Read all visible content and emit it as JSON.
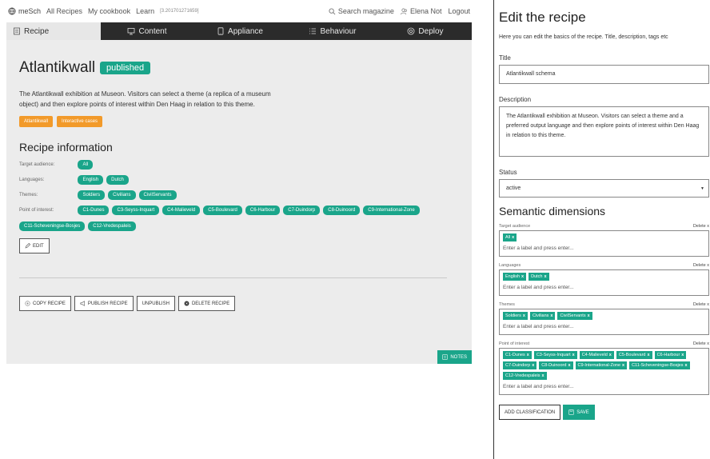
{
  "topbar": {
    "logo": "meSch",
    "links": [
      "All Recipes",
      "My cookbook",
      "Learn"
    ],
    "build": "[3.201701271659]",
    "search": "Search magazine",
    "user": "Elena Not",
    "logout": "Logout"
  },
  "tabs": [
    {
      "label": "Recipe",
      "icon": "document-icon"
    },
    {
      "label": "Content",
      "icon": "monitor-icon"
    },
    {
      "label": "Appliance",
      "icon": "tablet-icon"
    },
    {
      "label": "Behaviour",
      "icon": "list-icon"
    },
    {
      "label": "Deploy",
      "icon": "settings-icon"
    }
  ],
  "recipe": {
    "title": "Atlantikwall",
    "status_badge": "published",
    "description": "The Atlantikwall exhibition at Museon. Visitors can select a theme (a replica of a museum object) and then explore points of interest within Den Haag in relation to this theme.",
    "tags": [
      "Atlantikwall",
      "Interactive cases"
    ],
    "section_title": "Recipe information",
    "info": {
      "target_audience": {
        "label": "Target audience:",
        "values": [
          "All"
        ]
      },
      "languages": {
        "label": "Languages:",
        "values": [
          "English",
          "Dutch"
        ]
      },
      "themes": {
        "label": "Themes:",
        "values": [
          "Soldiers",
          "Civilians",
          "CivilServants"
        ]
      },
      "poi": {
        "label": "Point of interest:",
        "values": [
          "C1-Dunes",
          "C3-Seyss-Inquart",
          "C4-Malieveld",
          "C5-Boulevard",
          "C6-Harbour",
          "C7-Duindorp",
          "C8-Duinoord",
          "C9-International-Zone",
          "C11-Scheveningse-Bosjes",
          "C12-Vredespaleis"
        ]
      }
    },
    "edit_label": "EDIT",
    "actions": {
      "copy": "COPY RECIPE",
      "publish": "PUBLISH RECIPE",
      "unpublish": "UNPUBLISH",
      "delete": "DELETE RECIPE"
    },
    "notes_label": "NOTES"
  },
  "panel": {
    "title": "Edit the recipe",
    "intro": "Here you can edit the basics of the recipe. Title, description, tags etc",
    "title_label": "Title",
    "title_value": "Atlantikwall schema",
    "description_label": "Description",
    "description_value": "The Atlantikwall exhibition at Museon. Visitors can select a theme and a preferred output language and then explore points of interest within Den Haag in relation to this theme.",
    "status_label": "Status",
    "status_value": "active",
    "semantic_title": "Semantic dimensions",
    "delete_label": "Delete x",
    "input_placeholder": "Enter a label and press enter...",
    "dimensions": [
      {
        "name": "Target audience",
        "tags": [
          "All"
        ]
      },
      {
        "name": "Languages",
        "tags": [
          "English",
          "Dutch"
        ]
      },
      {
        "name": "Themes",
        "tags": [
          "Soldiers",
          "Civilians",
          "CivilServants"
        ]
      },
      {
        "name": "Point of interest",
        "tags": [
          "C1-Dunes",
          "C3-Seyss-Inquart",
          "C4-Malieveld",
          "C5-Boulevard",
          "C6-Harbour",
          "C7-Duindorp",
          "C8-Duinoord",
          "C9-International-Zone",
          "C11-Scheveningse-Bosjes",
          "C12-Vredespaleis"
        ]
      }
    ],
    "tag_remove": "x",
    "add_classification": "ADD CLASSIFICATION",
    "save": "SAVE"
  },
  "colors": {
    "accent": "#1aa58a",
    "orange": "#f29a2a",
    "dark": "#2b2b2b"
  }
}
